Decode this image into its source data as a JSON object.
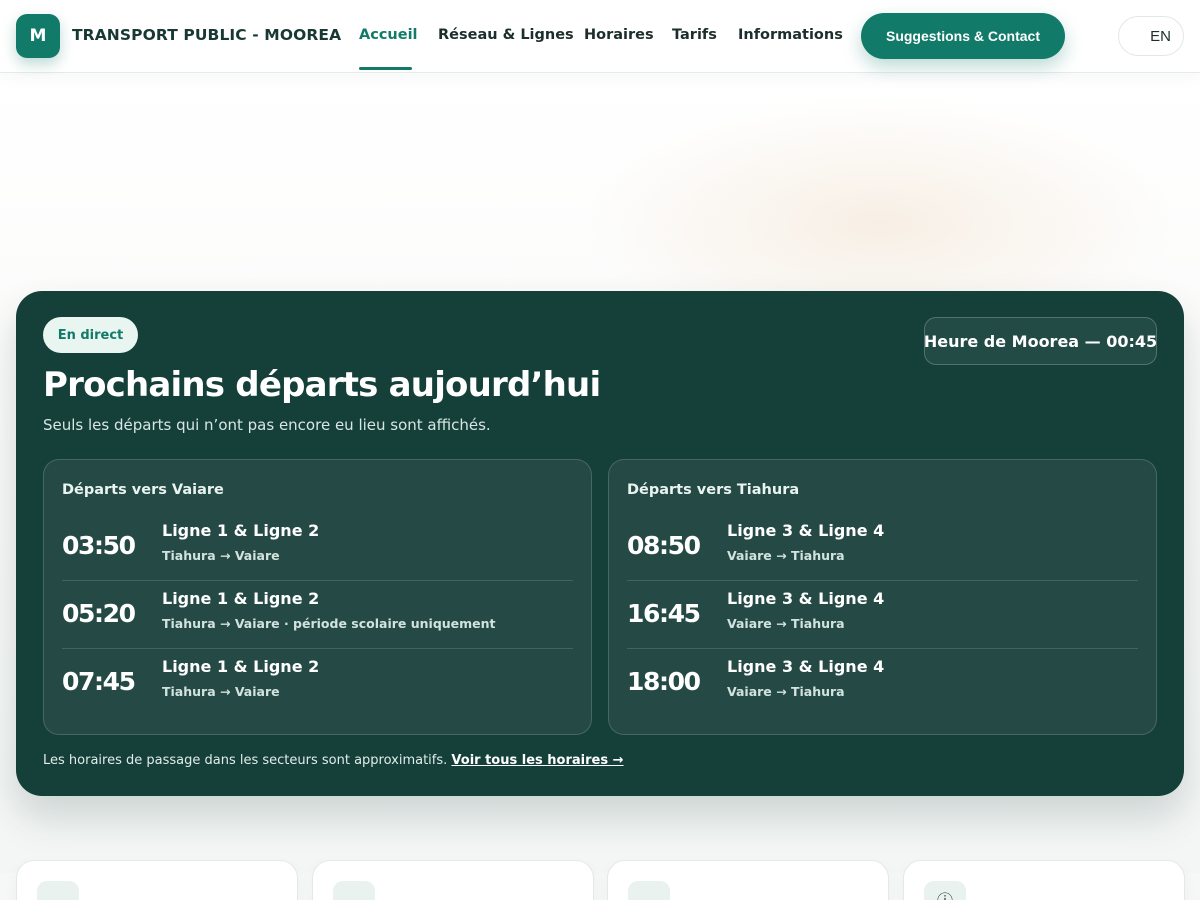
{
  "header": {
    "logo_letter": "M",
    "brand": "TRANSPORT PUBLIC - MOOREA",
    "nav": [
      {
        "label": "Accueil",
        "active": true
      },
      {
        "label": "Réseau & Lignes",
        "active": false
      },
      {
        "label": "Horaires",
        "active": false
      },
      {
        "label": "Tarifs",
        "active": false
      },
      {
        "label": "Informations",
        "active": false
      }
    ],
    "cta_label": "Suggestions & Contact",
    "lang_label": "EN"
  },
  "departures": {
    "live_label": "En direct",
    "clock": "Heure de Moorea — 00:45",
    "title": "Prochains départs aujourd’hui",
    "subtitle": "Seuls les départs qui n’ont pas encore eu lieu sont affichés.",
    "directions": [
      {
        "title": "Départs vers Vaiare",
        "rows": [
          {
            "time": "03:50",
            "line": "Ligne 1 & Ligne 2",
            "route": "Tiahura → Vaiare"
          },
          {
            "time": "05:20",
            "line": "Ligne 1 & Ligne 2",
            "route": "Tiahura → Vaiare · période scolaire uniquement"
          },
          {
            "time": "07:45",
            "line": "Ligne 1 & Ligne 2",
            "route": "Tiahura → Vaiare"
          }
        ]
      },
      {
        "title": "Départs vers Tiahura",
        "rows": [
          {
            "time": "08:50",
            "line": "Ligne 3 & Ligne 4",
            "route": "Vaiare → Tiahura"
          },
          {
            "time": "16:45",
            "line": "Ligne 3 & Ligne 4",
            "route": "Vaiare → Tiahura"
          },
          {
            "time": "18:00",
            "line": "Ligne 3 & Ligne 4",
            "route": "Vaiare → Tiahura"
          }
        ]
      }
    ],
    "note": "Les horaires de passage dans les secteurs sont approximatifs.",
    "note_link": "Voir tous les horaires →"
  },
  "feature_cards": [
    {
      "icon": ""
    },
    {
      "icon": ""
    },
    {
      "icon": ""
    },
    {
      "icon": "ⓘ"
    }
  ],
  "colors": {
    "accent": "#117a68",
    "panel": "#15403a",
    "panel_card": "#254a45"
  }
}
